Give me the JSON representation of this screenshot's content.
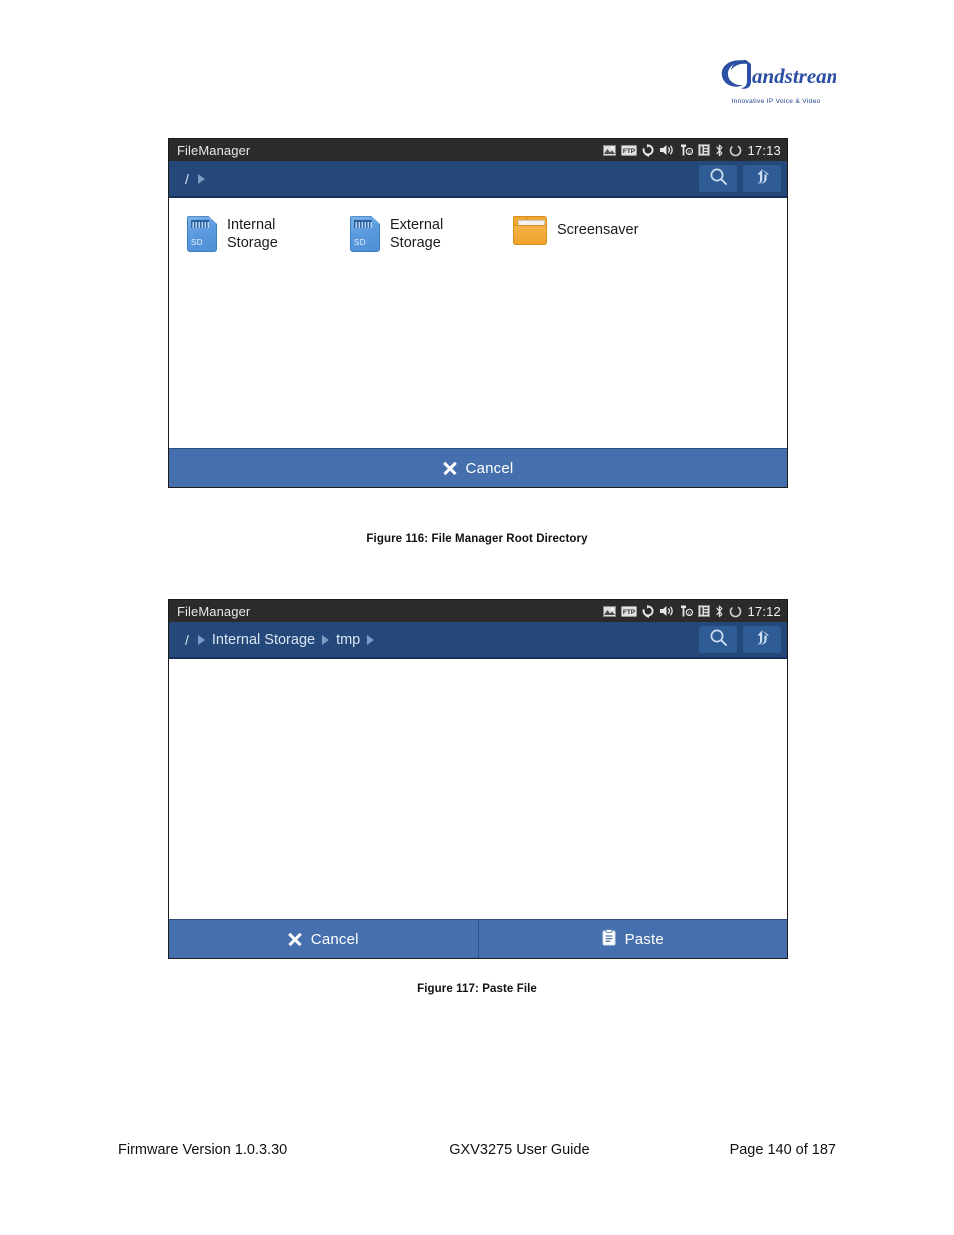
{
  "brand": {
    "name": "Grandstream",
    "tagline": "Innovative IP Voice & Video"
  },
  "figures": [
    {
      "caption": "Figure 116: File Manager Root Directory",
      "statusbar": {
        "app_title": "FileManager",
        "time": "17:13",
        "icons": [
          "picture-icon",
          "ftp-icon",
          "sync-icon",
          "speaker-icon",
          "tool-icon",
          "sim-card-icon",
          "bluetooth-icon",
          "loading-icon"
        ]
      },
      "toolbar": {
        "breadcrumbs": [
          "/"
        ],
        "search_label": "search-icon",
        "up_label": "up-arrow-icon"
      },
      "files": [
        {
          "name": "Internal Storage",
          "line1": "Internal",
          "line2": "Storage",
          "icon": "sd-card-icon"
        },
        {
          "name": "External Storage",
          "line1": "External",
          "line2": "Storage",
          "icon": "sd-card-icon"
        },
        {
          "name": "Screensaver",
          "line1": "Screensaver",
          "line2": "",
          "icon": "folder-icon"
        }
      ],
      "actions": [
        {
          "label": "Cancel",
          "icon": "close-icon"
        }
      ]
    },
    {
      "caption": "Figure 117: Paste File",
      "statusbar": {
        "app_title": "FileManager",
        "time": "17:12",
        "icons": [
          "picture-icon",
          "ftp-icon",
          "sync-icon",
          "speaker-icon",
          "tool-icon",
          "sim-card-icon",
          "bluetooth-icon",
          "loading-icon"
        ]
      },
      "toolbar": {
        "breadcrumbs": [
          "/",
          "Internal Storage",
          "tmp"
        ],
        "search_label": "search-icon",
        "up_label": "up-arrow-icon"
      },
      "files": [],
      "actions": [
        {
          "label": "Cancel",
          "icon": "close-icon"
        },
        {
          "label": "Paste",
          "icon": "clipboard-icon"
        }
      ]
    }
  ],
  "footer": {
    "left": "Firmware Version 1.0.3.30",
    "center": "GXV3275 User Guide",
    "right": "Page 140 of 187"
  },
  "colors": {
    "statusbar_bg": "#2b2b2b",
    "toolbar_bg": "#24487a",
    "toolbar_button_bg": "#2f5c94",
    "actionbar_bg": "#4570ad",
    "folder_orange": "#f0a833",
    "sdcard_blue": "#5b9ade",
    "brand_blue": "#1e3d8f"
  }
}
